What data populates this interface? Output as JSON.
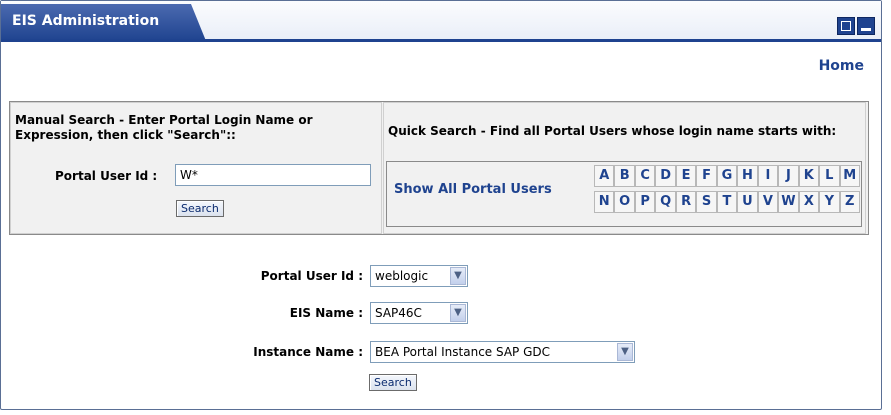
{
  "portlet": {
    "title": "EIS Administration",
    "home_link": "Home"
  },
  "manual_search": {
    "title": "Manual Search - Enter Portal Login Name or Expression, then click \"Search\"::",
    "user_id_label": "Portal User Id :",
    "user_id_value": "W*",
    "search_button": "Search"
  },
  "quick_search": {
    "title": "Quick Search - Find all Portal Users whose login name starts with:",
    "show_all_link": "Show All Portal Users",
    "letters": [
      "A",
      "B",
      "C",
      "D",
      "E",
      "F",
      "G",
      "H",
      "I",
      "J",
      "K",
      "L",
      "M",
      "N",
      "O",
      "P",
      "Q",
      "R",
      "S",
      "T",
      "U",
      "V",
      "W",
      "X",
      "Y",
      "Z"
    ]
  },
  "form": {
    "user_id_label": "Portal User Id :",
    "user_id_value": "weblogic",
    "eis_name_label": "EIS Name :",
    "eis_name_value": "SAP46C",
    "instance_label": "Instance Name :",
    "instance_value": "BEA Portal Instance SAP GDC",
    "search_button": "Search"
  },
  "colors": {
    "accent": "#1f438f",
    "panel_bg": "#f1f1f1",
    "title_text": "#ffffff"
  },
  "icons": {
    "maximize": "maximize-icon",
    "minimize": "minimize-icon",
    "dropdown": "chevron-down-icon"
  }
}
